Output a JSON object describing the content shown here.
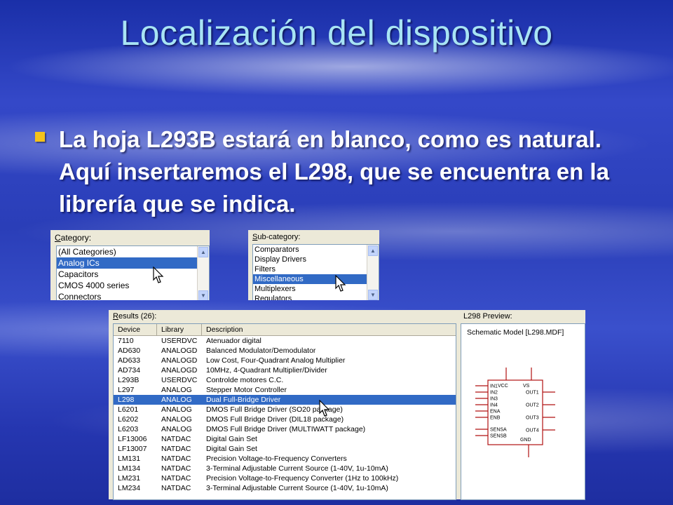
{
  "slide": {
    "title": "Localización del dispositivo",
    "bullet": "La hoja L293B estará en blanco, como es natural. Aquí insertaremos el L298, que se encuentra en la librería que se indica."
  },
  "category_panel": {
    "label_underlined": "C",
    "label_rest": "ategory:",
    "items": [
      "(All Categories)",
      "Analog ICs",
      "Capacitors",
      "CMOS 4000 series",
      "Connectors"
    ],
    "selected": "Analog ICs"
  },
  "subcategory_panel": {
    "label_underlined": "S",
    "label_rest": "ub-category:",
    "items": [
      "Comparators",
      "Display Drivers",
      "Filters",
      "Miscellaneous",
      "Multiplexers",
      "Regulators"
    ],
    "selected": "Miscellaneous"
  },
  "results": {
    "label_underlined": "R",
    "label_rest": "esults (26):",
    "columns": [
      "Device",
      "Library",
      "Description"
    ],
    "rows": [
      [
        "7110",
        "USERDVC",
        "Atenuador digital"
      ],
      [
        "AD630",
        "ANALOGD",
        "Balanced Modulator/Demodulator"
      ],
      [
        "AD633",
        "ANALOGD",
        "Low Cost, Four-Quadrant Analog Multiplier"
      ],
      [
        "AD734",
        "ANALOGD",
        "10MHz, 4-Quadrant Multiplier/Divider"
      ],
      [
        "L293B",
        "USERDVC",
        "Controlde motores C.C."
      ],
      [
        "L297",
        "ANALOG",
        "Stepper Motor Controller"
      ],
      [
        "L298",
        "ANALOG",
        "Dual Full-Bridge Driver"
      ],
      [
        "L6201",
        "ANALOG",
        "DMOS Full Bridge Driver (SO20 package)"
      ],
      [
        "L6202",
        "ANALOG",
        "DMOS Full Bridge Driver (DIL18 package)"
      ],
      [
        "L6203",
        "ANALOG",
        "DMOS Full Bridge Driver (MULTIWATT package)"
      ],
      [
        "LF13006",
        "NATDAC",
        "Digital Gain Set"
      ],
      [
        "LF13007",
        "NATDAC",
        "Digital Gain Set"
      ],
      [
        "LM131",
        "NATDAC",
        "Precision Voltage-to-Frequency Converters"
      ],
      [
        "LM134",
        "NATDAC",
        "3-Terminal Adjustable Current Source (1-40V, 1u-10mA)"
      ],
      [
        "LM231",
        "NATDAC",
        "Precision Voltage-to-Frequency Converter (1Hz to 100kHz)"
      ],
      [
        "LM234",
        "NATDAC",
        "3-Terminal Adjustable Current Source (1-40V, 1u-10mA)"
      ]
    ],
    "selected_device": "L298"
  },
  "preview": {
    "label": "L298 Preview:",
    "model": "Schematic Model [L298.MDF]",
    "pins_left": [
      "IN1",
      "IN2",
      "IN3",
      "IN4",
      "ENA",
      "ENB",
      "SENSA",
      "SENSB"
    ],
    "pins_right": [
      "OUT1",
      "OUT2",
      "OUT3",
      "OUT4"
    ],
    "pins_top": [
      "VCC",
      "VS"
    ],
    "pin_bottom": "GND"
  },
  "colors": {
    "bullet": "#f4c21a",
    "title": "#a8e4f4",
    "selection": "#316ac5",
    "schematic": "#b01010"
  }
}
